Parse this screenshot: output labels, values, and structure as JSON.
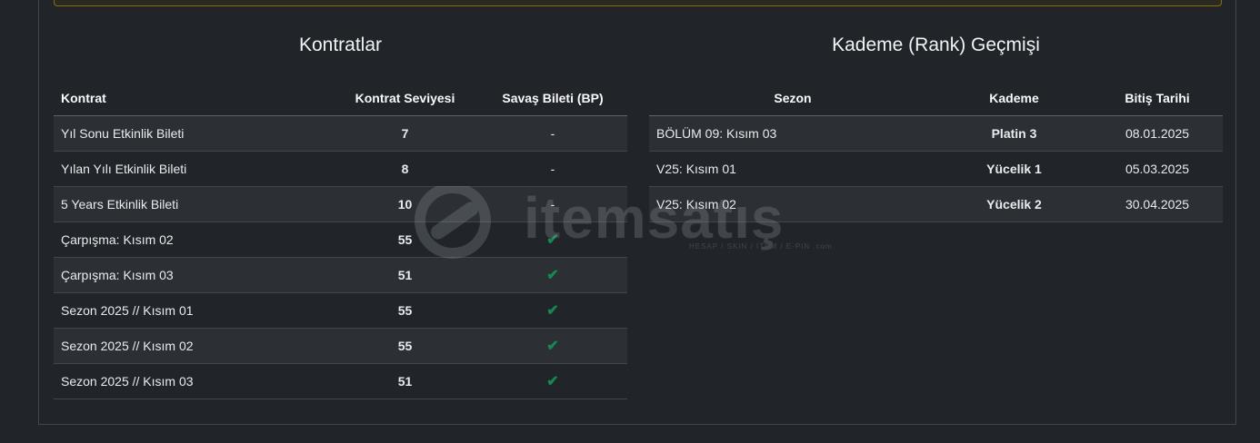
{
  "contracts": {
    "title": "Kontratlar",
    "headers": [
      "Kontrat",
      "Kontrat Seviyesi",
      "Savaş Bileti (BP)"
    ],
    "rows": [
      {
        "name": "Yıl Sonu Etkinlik Bileti",
        "level": "7",
        "bp": "-",
        "bp_check": false
      },
      {
        "name": "Yılan Yılı Etkinlik Bileti",
        "level": "8",
        "bp": "-",
        "bp_check": false
      },
      {
        "name": "5 Years Etkinlik Bileti",
        "level": "10",
        "bp": "-",
        "bp_check": false
      },
      {
        "name": "Çarpışma: Kısım 02",
        "level": "55",
        "bp": "✔",
        "bp_check": true
      },
      {
        "name": "Çarpışma: Kısım 03",
        "level": "51",
        "bp": "✔",
        "bp_check": true
      },
      {
        "name": "Sezon 2025 // Kısım 01",
        "level": "55",
        "bp": "✔",
        "bp_check": true
      },
      {
        "name": "Sezon 2025 // Kısım 02",
        "level": "55",
        "bp": "✔",
        "bp_check": true
      },
      {
        "name": "Sezon 2025 // Kısım 03",
        "level": "51",
        "bp": "✔",
        "bp_check": true
      }
    ]
  },
  "rank_history": {
    "title": "Kademe (Rank) Geçmişi",
    "headers": [
      "Sezon",
      "Kademe",
      "Bitiş Tarihi"
    ],
    "rows": [
      {
        "season": "BÖLÜM 09: Kısım 03",
        "rank": "Platin 3",
        "end_date": "08.01.2025"
      },
      {
        "season": "V25: Kısım 01",
        "rank": "Yücelik 1",
        "end_date": "05.03.2025"
      },
      {
        "season": "V25: Kısım 02",
        "rank": "Yücelik 2",
        "end_date": "30.04.2025"
      }
    ]
  },
  "watermark": {
    "brand": "itemsatış",
    "tagline": "HESAP / SKIN / ITEM / E-PIN",
    "suffix": ".com"
  },
  "colors": {
    "check": "#198754",
    "alert_border": "#8a6d0b"
  }
}
